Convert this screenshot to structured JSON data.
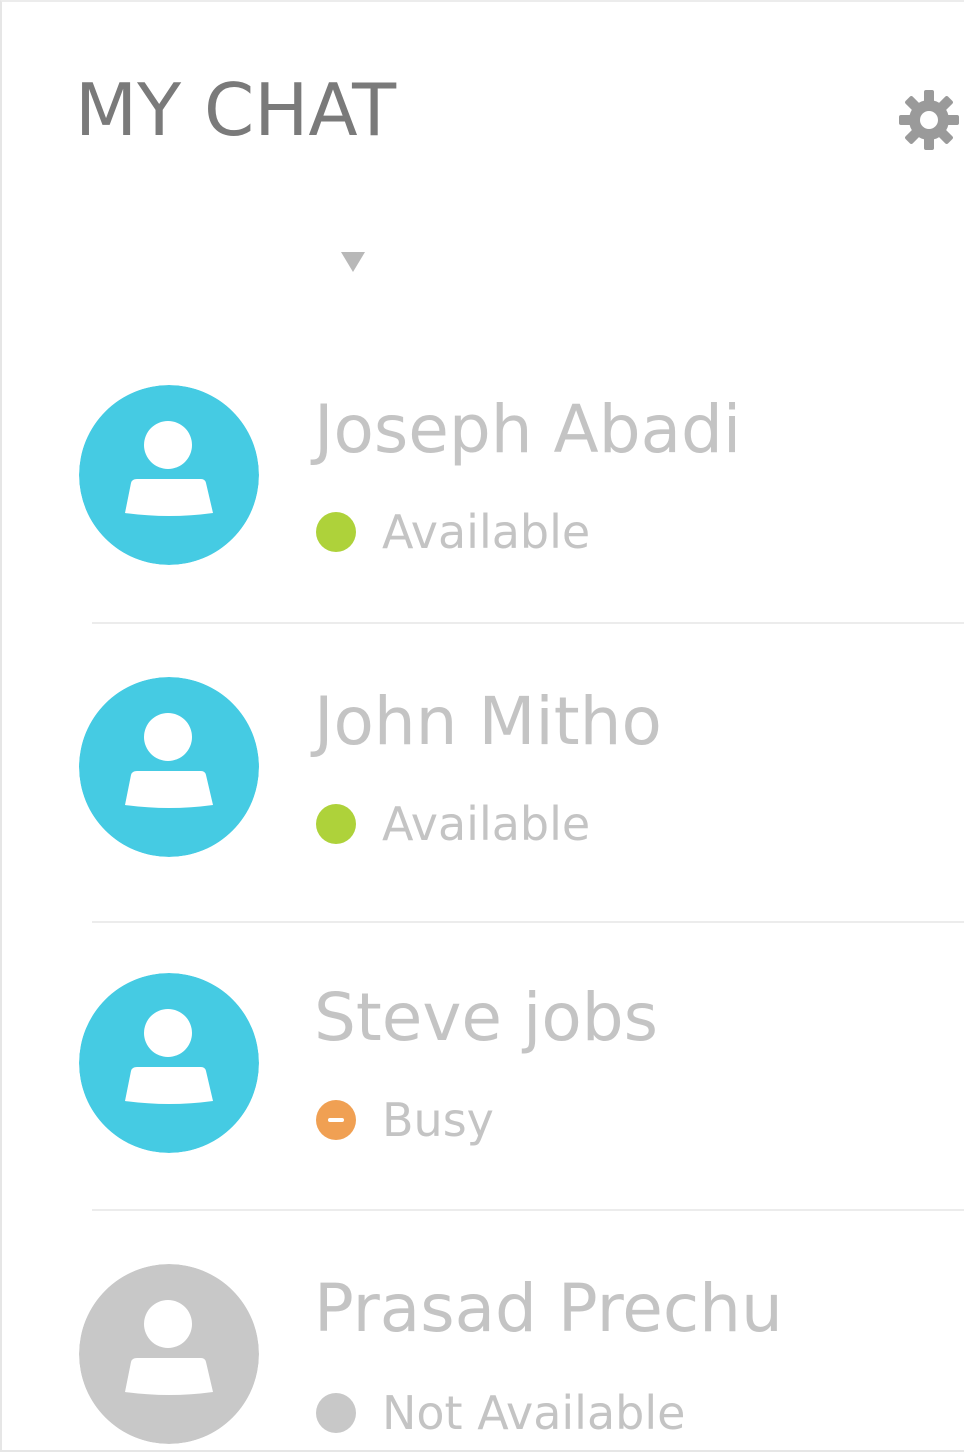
{
  "header": {
    "title": "MY CHAT",
    "settings_icon": "gear-icon",
    "dropdown_icon": "caret-down-icon"
  },
  "colors": {
    "avatar_active": "#45cbe3",
    "avatar_inactive": "#c8c8c8",
    "available": "#aed23a",
    "busy": "#f0a053",
    "not_available": "#c8c8c8"
  },
  "contacts": [
    {
      "name": "Joseph Abadi",
      "status": "Available",
      "status_type": "available"
    },
    {
      "name": "John Mitho",
      "status": "Available",
      "status_type": "available"
    },
    {
      "name": "Steve jobs",
      "status": "Busy",
      "status_type": "busy"
    },
    {
      "name": "Prasad Prechu",
      "status": "Not Available",
      "status_type": "not_available"
    }
  ]
}
